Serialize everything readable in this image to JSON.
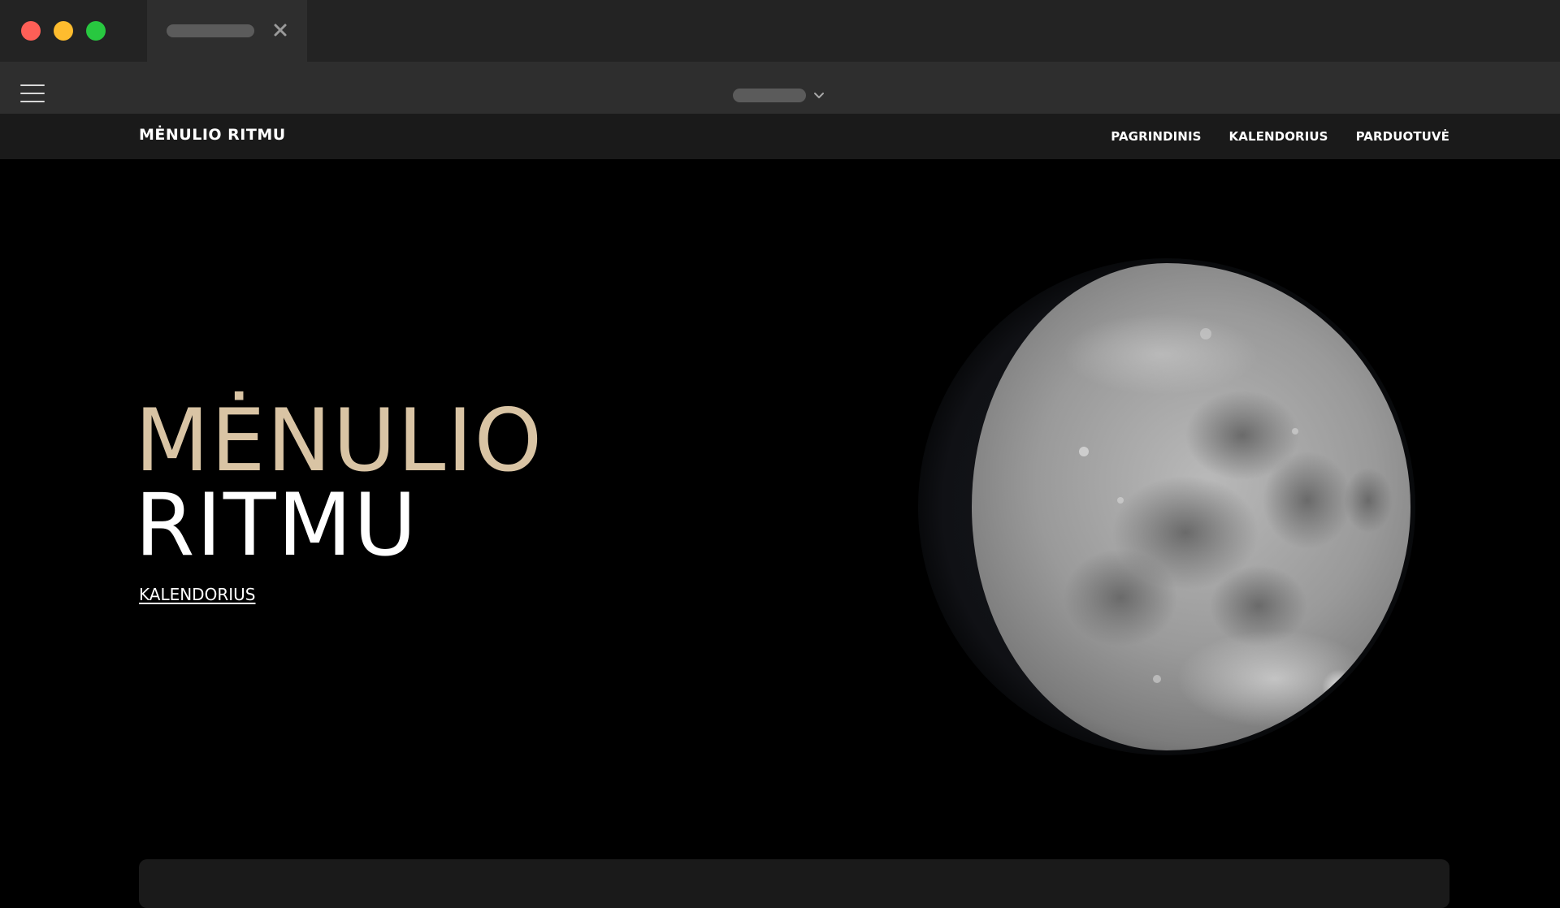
{
  "window": {
    "colors": {
      "close": "#fe5f57",
      "minimize": "#febc2e",
      "zoom": "#28c840"
    }
  },
  "tab": {
    "close_glyph": "✕"
  },
  "site": {
    "brand": "MĖNULIO RITMU",
    "nav": [
      {
        "label": "PAGRINDINIS"
      },
      {
        "label": "KALENDORIUS"
      },
      {
        "label": "PARDUOTUVĖ"
      }
    ]
  },
  "hero": {
    "title_line1": "MĖNULIO",
    "title_line2": "RITMU",
    "link": "KALENDORIUS",
    "accent_color": "#d9c4a4",
    "image": "moon-image"
  }
}
